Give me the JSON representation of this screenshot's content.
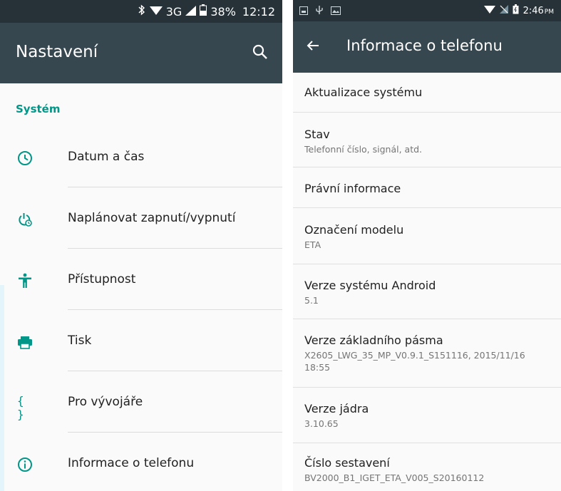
{
  "left": {
    "status": {
      "network": "3G",
      "battery": "38%",
      "time": "12:12"
    },
    "appbar": {
      "title": "Nastavení"
    },
    "section_title": "Systém",
    "items": [
      {
        "label": "Datum a čas",
        "icon": "clock-icon"
      },
      {
        "label": "Naplánovat zapnutí/vypnutí",
        "icon": "power-schedule-icon"
      },
      {
        "label": "Přístupnost",
        "icon": "accessibility-icon"
      },
      {
        "label": "Tisk",
        "icon": "printer-icon"
      },
      {
        "label": "Pro vývojáře",
        "icon": "developer-braces-icon"
      },
      {
        "label": "Informace o telefonu",
        "icon": "info-icon"
      }
    ]
  },
  "right": {
    "status": {
      "time": "2:46",
      "ampm": "PM"
    },
    "appbar": {
      "title": "Informace o telefonu"
    },
    "items": [
      {
        "title": "Aktualizace systému"
      },
      {
        "title": "Stav",
        "subtitle": "Telefonní číslo, signál, atd."
      },
      {
        "title": "Právní informace"
      },
      {
        "title": "Označení modelu",
        "subtitle": "ETA"
      },
      {
        "title": "Verze systému Android",
        "subtitle": "5.1"
      },
      {
        "title": "Verze základního pásma",
        "subtitle": "X2605_LWG_35_MP_V0.9.1_S151116, 2015/11/16 18:55"
      },
      {
        "title": "Verze jádra",
        "subtitle": "3.10.65"
      },
      {
        "title": "Číslo sestavení",
        "subtitle": "BV2000_B1_IGET_ETA_V005_S20160112"
      }
    ]
  },
  "colors": {
    "accent": "#009688",
    "appbar": "#37474f",
    "statusbar": "#263238"
  }
}
